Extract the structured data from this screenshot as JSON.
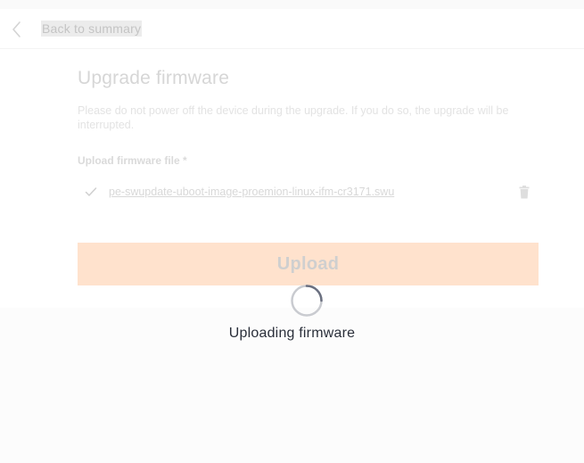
{
  "header": {
    "back_label": "Back to summary",
    "back_icon": "chevron-left-icon"
  },
  "main": {
    "title": "Upgrade firmware",
    "description": "Please do not power off the device during the upgrade. If you do so, the upgrade will be interrupted.",
    "file_label": "Upload firmware file *",
    "file_name": "pe-swupdate-uboot-image-proemion-linux-ifm-cr3171.swu",
    "file_status_icon": "check-icon",
    "delete_icon": "trash-icon",
    "upload_button_label": "Upload"
  },
  "overlay": {
    "spinner_icon": "spinner-icon",
    "message": "Uploading firmware"
  },
  "colors": {
    "upload_button_bg": "#ffe2cd",
    "overlay_text": "#2a2f3a",
    "page_bg": "#fcfcfc"
  }
}
